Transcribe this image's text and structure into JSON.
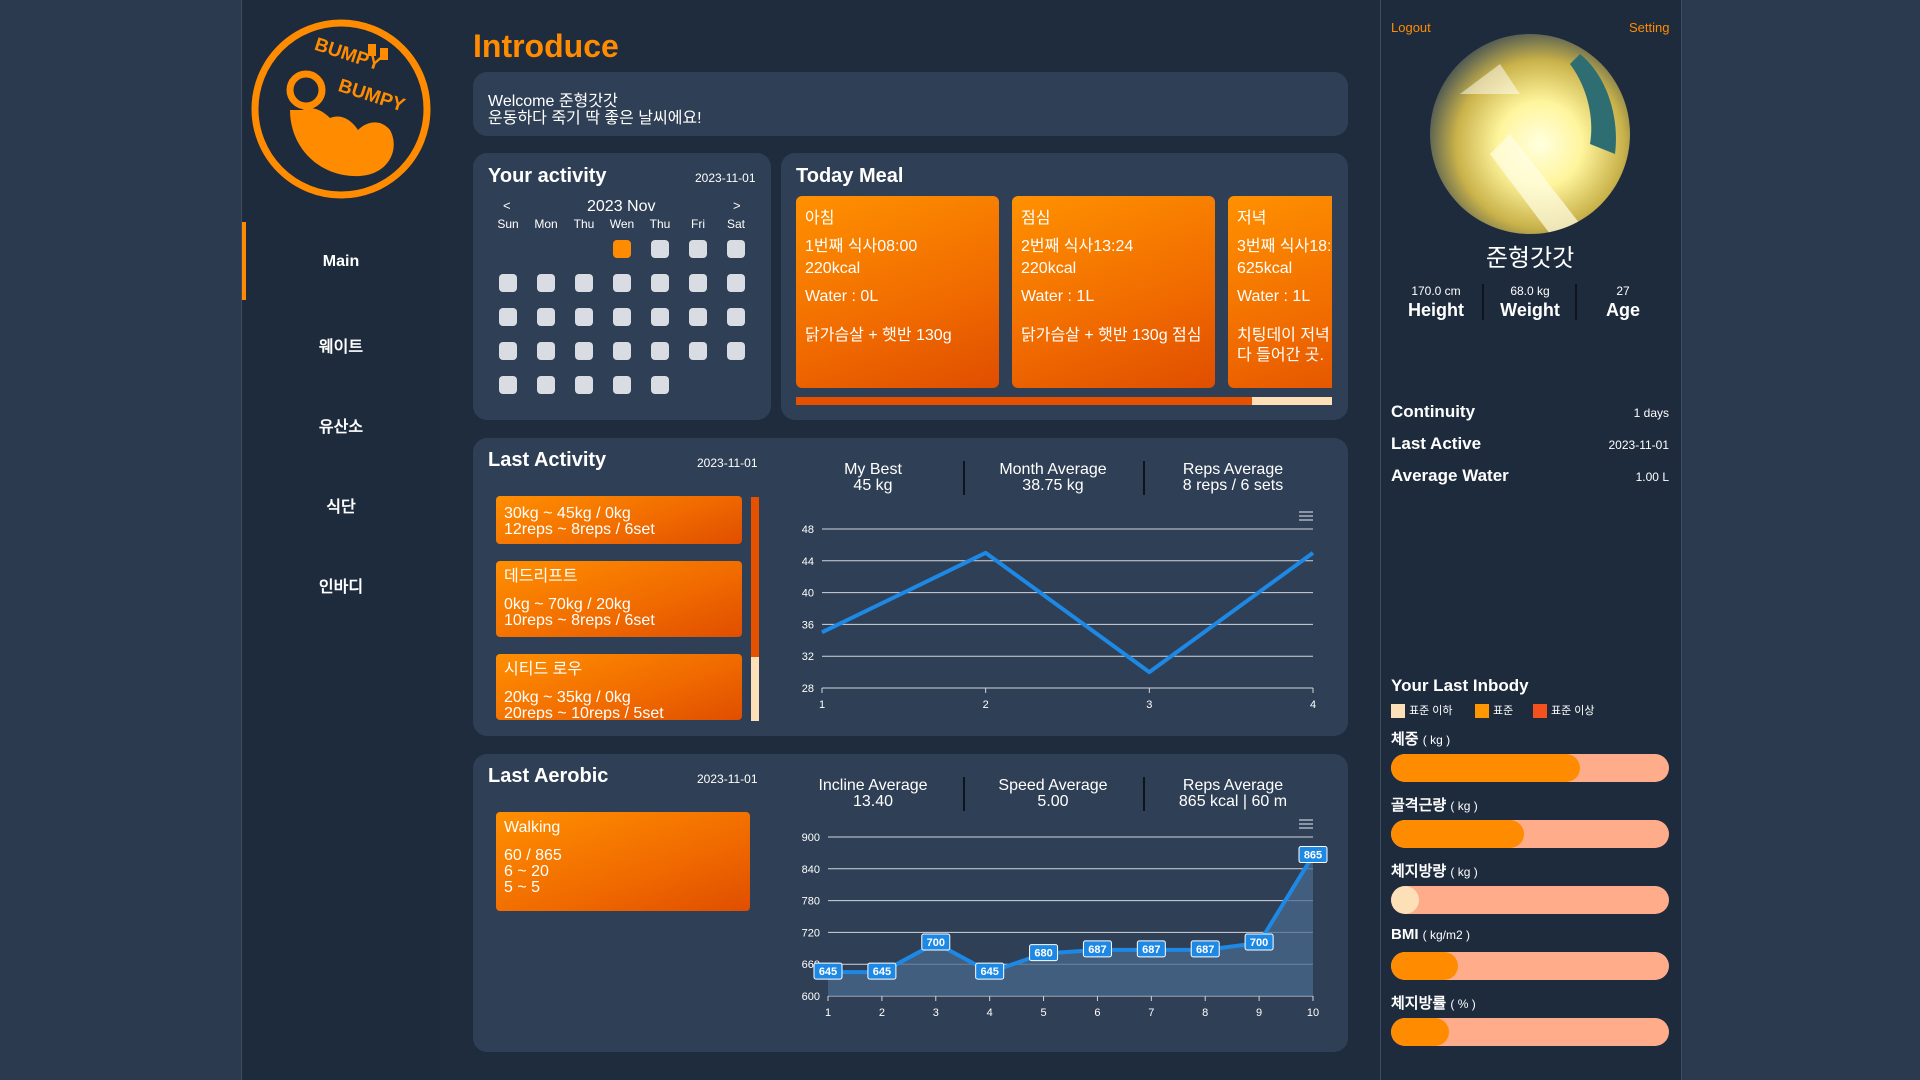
{
  "sidebar": {
    "logo_text": [
      "BUMPY",
      "BUMPY"
    ],
    "items": [
      {
        "label": "Main"
      },
      {
        "label": "웨이트"
      },
      {
        "label": "유산소"
      },
      {
        "label": "식단"
      },
      {
        "label": "인바디"
      }
    ]
  },
  "main": {
    "title": "Introduce",
    "welcome_line1": "Welcome 준형갓갓",
    "welcome_line2": "운동하다 죽기 딱 좋은 날씨에요!",
    "activity": {
      "title": "Your activity",
      "date": "2023-11-01",
      "month_label": "2023 Nov",
      "prev": "<",
      "next": ">",
      "weekdays": [
        "Sun",
        "Mon",
        "Thu",
        "Wen",
        "Thu",
        "Fri",
        "Sat"
      ],
      "days_in_month": 30,
      "first_weekday": 3,
      "active_days": [
        1
      ]
    },
    "meal": {
      "title": "Today Meal",
      "items": [
        {
          "time": "아침",
          "name": "1번째 식사08:00",
          "kcal": "220kcal",
          "water": "Water : 0L",
          "desc": "닭가슴살 + 햇반 130g"
        },
        {
          "time": "점심",
          "name": "2번째 식사13:24",
          "kcal": "220kcal",
          "water": "Water : 1L",
          "desc": "닭가슴살 + 햇반 130g 점심"
        },
        {
          "time": "저녁",
          "name": "3번째 식사18:",
          "kcal": "625kcal",
          "water": "Water : 1L",
          "desc": "치팅데이 저녁",
          "desc2": "다 들어간 곳."
        }
      ],
      "scroll_progress": 0.85
    },
    "last_activity": {
      "title": "Last Activity",
      "date": "2023-11-01",
      "items": [
        {
          "name": "",
          "weight": "30kg ~ 45kg / 0kg",
          "reps": "12reps ~ 8reps / 6set"
        },
        {
          "name": "데드리프트",
          "weight": "0kg ~ 70kg / 20kg",
          "reps": "10reps ~ 8reps / 6set"
        },
        {
          "name": "시티드 로우",
          "weight": "20kg ~ 35kg / 0kg",
          "reps": "20reps ~ 10reps / 5set"
        }
      ],
      "stats": [
        {
          "label": "My Best",
          "value": "45 kg"
        },
        {
          "label": "Month Average",
          "value": "38.75 kg"
        },
        {
          "label": "Reps Average",
          "value": "8 reps / 6 sets"
        }
      ]
    },
    "last_aerobic": {
      "title": "Last Aerobic",
      "date": "2023-11-01",
      "item": {
        "name": "Walking",
        "line1": "60 / 865",
        "line2": "6 ~ 20",
        "line3": "5 ~ 5"
      },
      "stats": [
        {
          "label": "Incline Average",
          "value": "13.40"
        },
        {
          "label": "Speed Average",
          "value": "5.00"
        },
        {
          "label": "Reps Average",
          "value": "865 kcal | 60 m"
        }
      ]
    }
  },
  "chart_data": [
    {
      "type": "line",
      "x": [
        1,
        2,
        3,
        4
      ],
      "values": [
        35,
        45,
        30,
        45
      ],
      "ylim": [
        28,
        48
      ],
      "yticks": [
        28,
        32,
        36,
        40,
        44,
        48
      ],
      "color": "#1e88e5"
    },
    {
      "type": "area",
      "x": [
        1,
        2,
        3,
        4,
        5,
        6,
        7,
        8,
        9,
        10
      ],
      "values": [
        645,
        645,
        700,
        645,
        680,
        687,
        687,
        687,
        700,
        865
      ],
      "data_labels": [
        "645",
        "645",
        "700",
        "645",
        "680",
        "687",
        "687",
        "687",
        "700",
        "865"
      ],
      "ylim": [
        600,
        900
      ],
      "yticks": [
        600,
        660,
        720,
        780,
        840,
        900
      ],
      "color": "#1e88e5"
    }
  ],
  "right": {
    "logout": "Logout",
    "setting": "Setting",
    "name": "준형갓갓",
    "metrics": [
      {
        "value": "170.0 cm",
        "label": "Height"
      },
      {
        "value": "68.0 kg",
        "label": "Weight"
      },
      {
        "value": "27",
        "label": "Age"
      }
    ],
    "summary": [
      {
        "label": "Continuity",
        "value": "1 days"
      },
      {
        "label": "Last Active",
        "value": "2023-11-01"
      },
      {
        "label": "Average Water",
        "value": "1.00 L"
      }
    ],
    "inbody_title": "Your Last Inbody",
    "legend": [
      {
        "label": "표준 이하",
        "color": "#fde0b8"
      },
      {
        "label": "표준",
        "color": "#ff9800"
      },
      {
        "label": "표준 이상",
        "color": "#f4511e"
      }
    ],
    "bars": [
      {
        "label": "체중",
        "unit": "( kg )",
        "level": 0.68,
        "fill": "#ff8c00"
      },
      {
        "label": "골격근량",
        "unit": "( kg )",
        "level": 0.48,
        "fill": "#ff8c00"
      },
      {
        "label": "체지방량",
        "unit": "( kg )",
        "level": 0.1,
        "fill": "#fde0b8"
      },
      {
        "label": "BMI",
        "unit": "( kg/m2 )",
        "level": 0.24,
        "fill": "#ff8c00"
      },
      {
        "label": "체지방률",
        "unit": "( % )",
        "level": 0.21,
        "fill": "#ff8c00"
      }
    ]
  }
}
